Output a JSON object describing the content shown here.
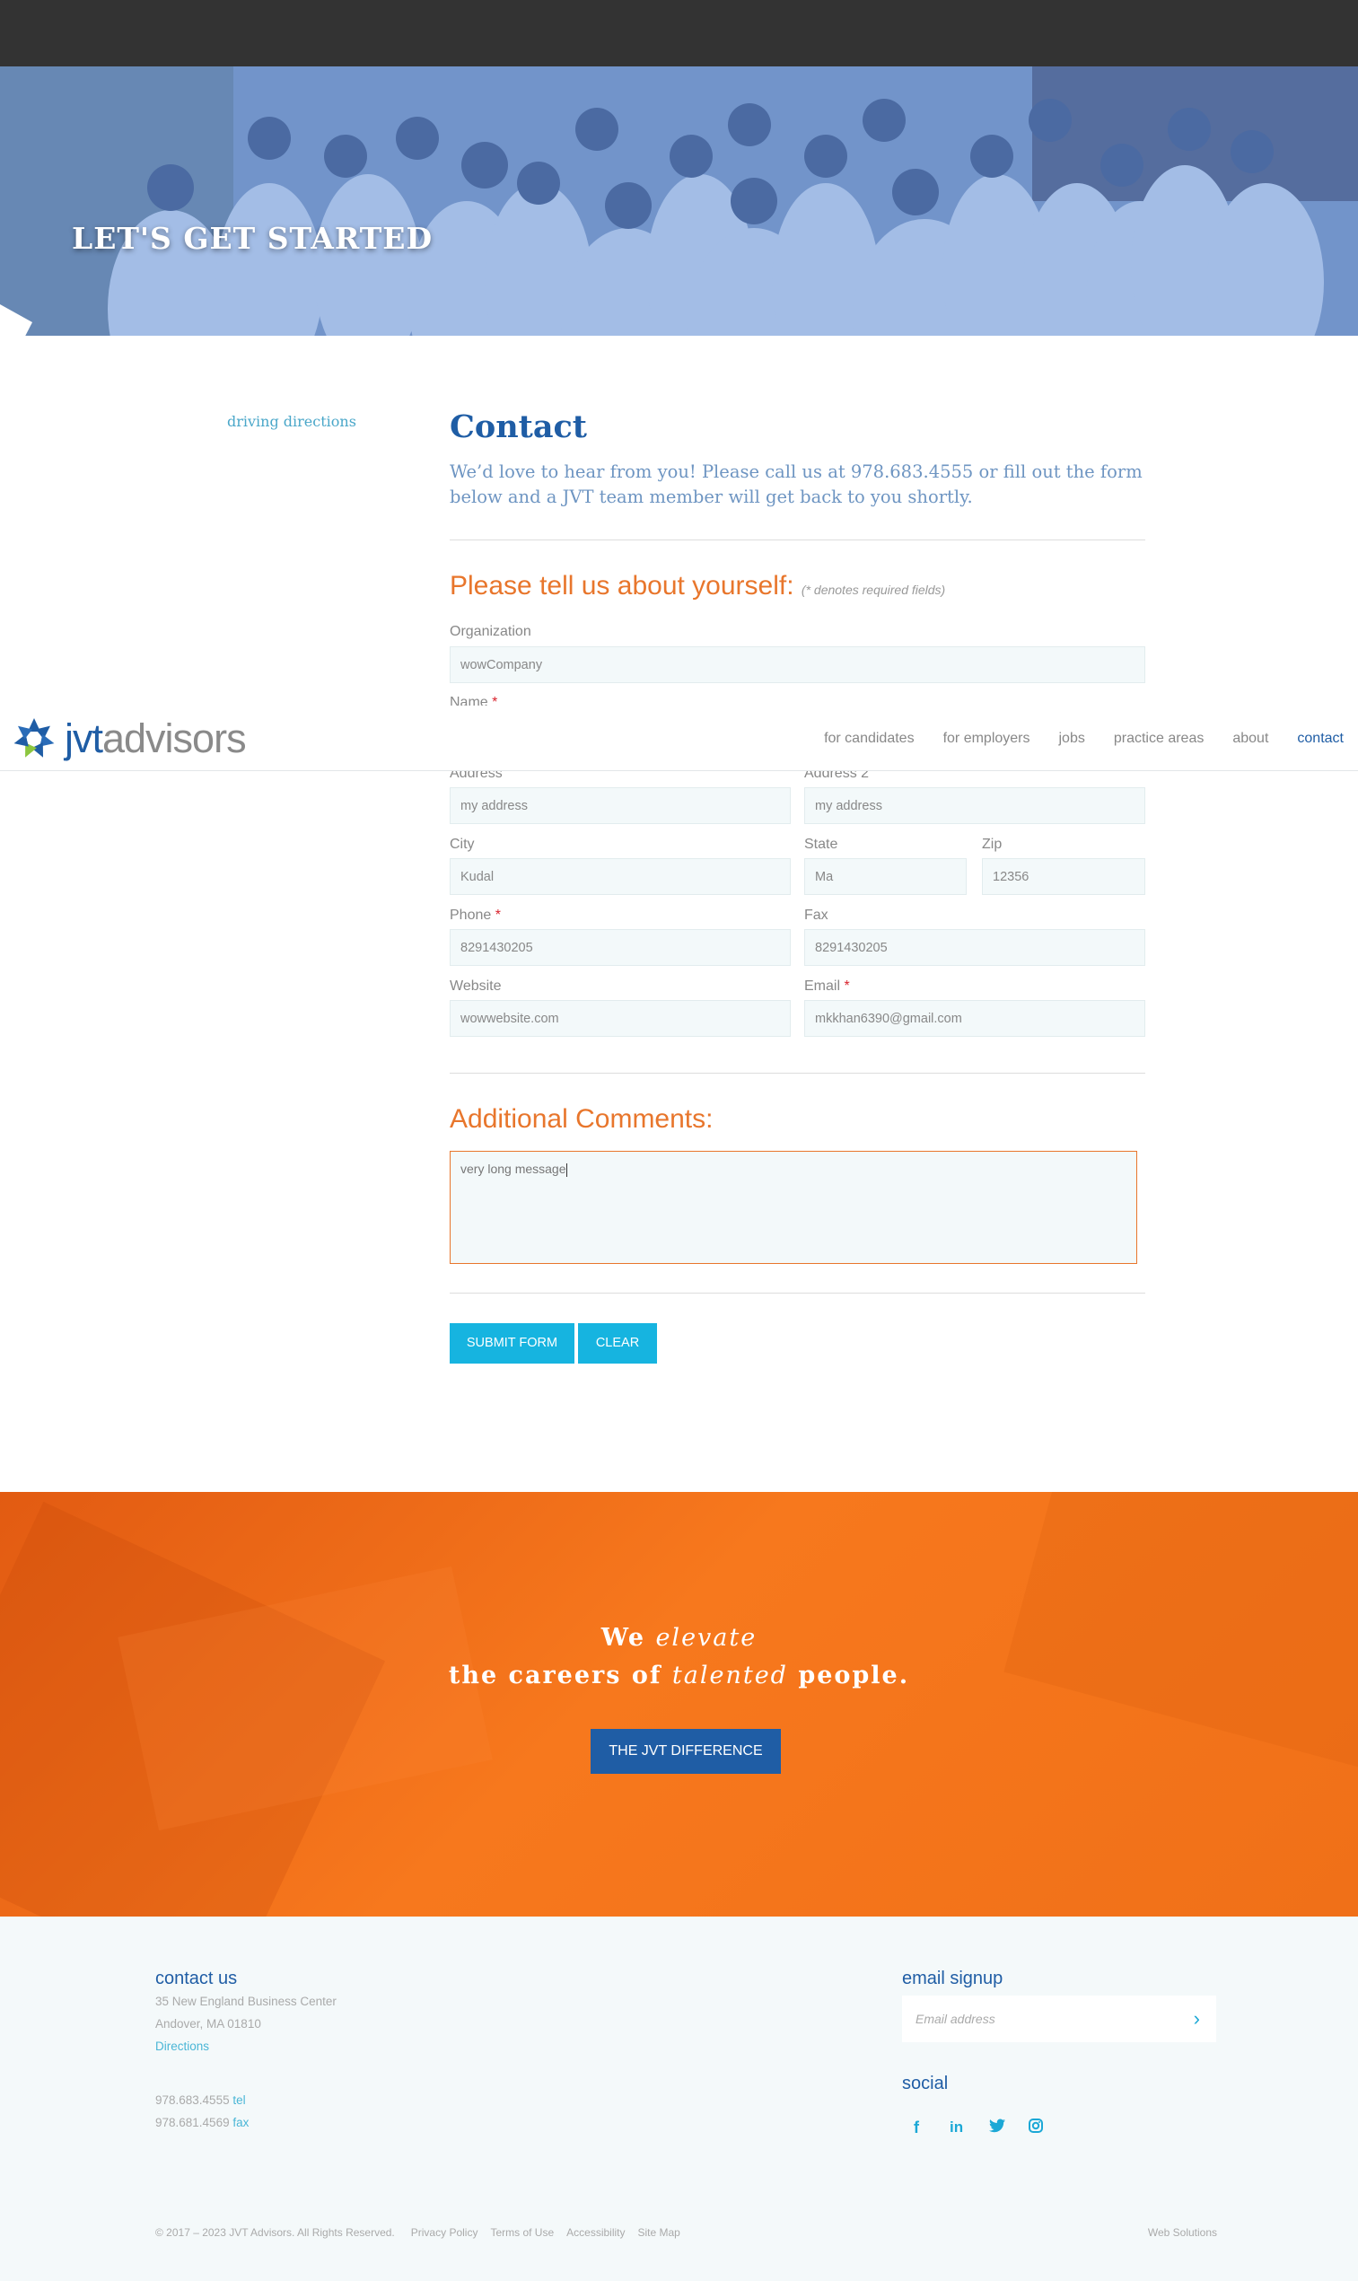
{
  "hero": {
    "title": "LET'S GET STARTED"
  },
  "sidebar": {
    "directions_label": "driving directions"
  },
  "contact": {
    "title": "Contact",
    "intro": "We’d love to hear from you! Please call us at 978.683.4555 or fill out the form below and a JVT team member will get back to you shortly."
  },
  "form": {
    "section_title": "Please tell us about yourself:",
    "required_note": "(* denotes required fields)",
    "required_marker": "*",
    "organization": {
      "label": "Organization",
      "value": "wowCompany"
    },
    "name": {
      "label": "Name"
    },
    "address": {
      "label": "Address",
      "value": "my address"
    },
    "address2": {
      "label": "Address 2",
      "value": "my address"
    },
    "city": {
      "label": "City",
      "value": "Kudal"
    },
    "state": {
      "label": "State",
      "value": "Ma"
    },
    "zip": {
      "label": "Zip",
      "value": "12356"
    },
    "phone": {
      "label": "Phone",
      "value": "8291430205"
    },
    "fax": {
      "label": "Fax",
      "value": "8291430205"
    },
    "website": {
      "label": "Website",
      "value": "wowwebsite.com"
    },
    "email": {
      "label": "Email",
      "value": "mkkhan6390@gmail.com"
    },
    "comments_title": "Additional Comments:",
    "comments_value": "very long message",
    "submit_label": "SUBMIT FORM",
    "clear_label": "CLEAR"
  },
  "nav": {
    "logo_jvt": "jvt",
    "logo_advisors": "advisors",
    "items": [
      "for candidates",
      "for employers",
      "jobs",
      "practice areas",
      "about",
      "contact"
    ],
    "active": "contact"
  },
  "cta": {
    "line1_a": "We ",
    "line1_b": "elevate",
    "line2_a": "the careers of ",
    "line2_b": "talented",
    "line2_c": " people.",
    "button_label": "THE JVT DIFFERENCE"
  },
  "footer": {
    "contact_title": "contact us",
    "address1": "35 New England Business Center",
    "address2": "Andover, MA 01810",
    "directions": "Directions",
    "tel_number": "978.683.4555",
    "tel_label": "tel",
    "fax_number": "978.681.4569",
    "fax_label": "fax",
    "signup_title": "email signup",
    "signup_placeholder": "Email address",
    "social_title": "social",
    "social_icons": [
      "facebook-icon",
      "linkedin-icon",
      "twitter-icon",
      "instagram-icon"
    ],
    "copyright": "© 2017 – 2023 JVT Advisors. All Rights Reserved.",
    "links": [
      "Privacy Policy",
      "Terms of Use",
      "Accessibility",
      "Site Map"
    ],
    "web_solutions": "Web Solutions"
  },
  "colors": {
    "brand_blue": "#1f5da5",
    "accent_orange": "#e8762c",
    "button_cyan": "#16b4e0"
  }
}
